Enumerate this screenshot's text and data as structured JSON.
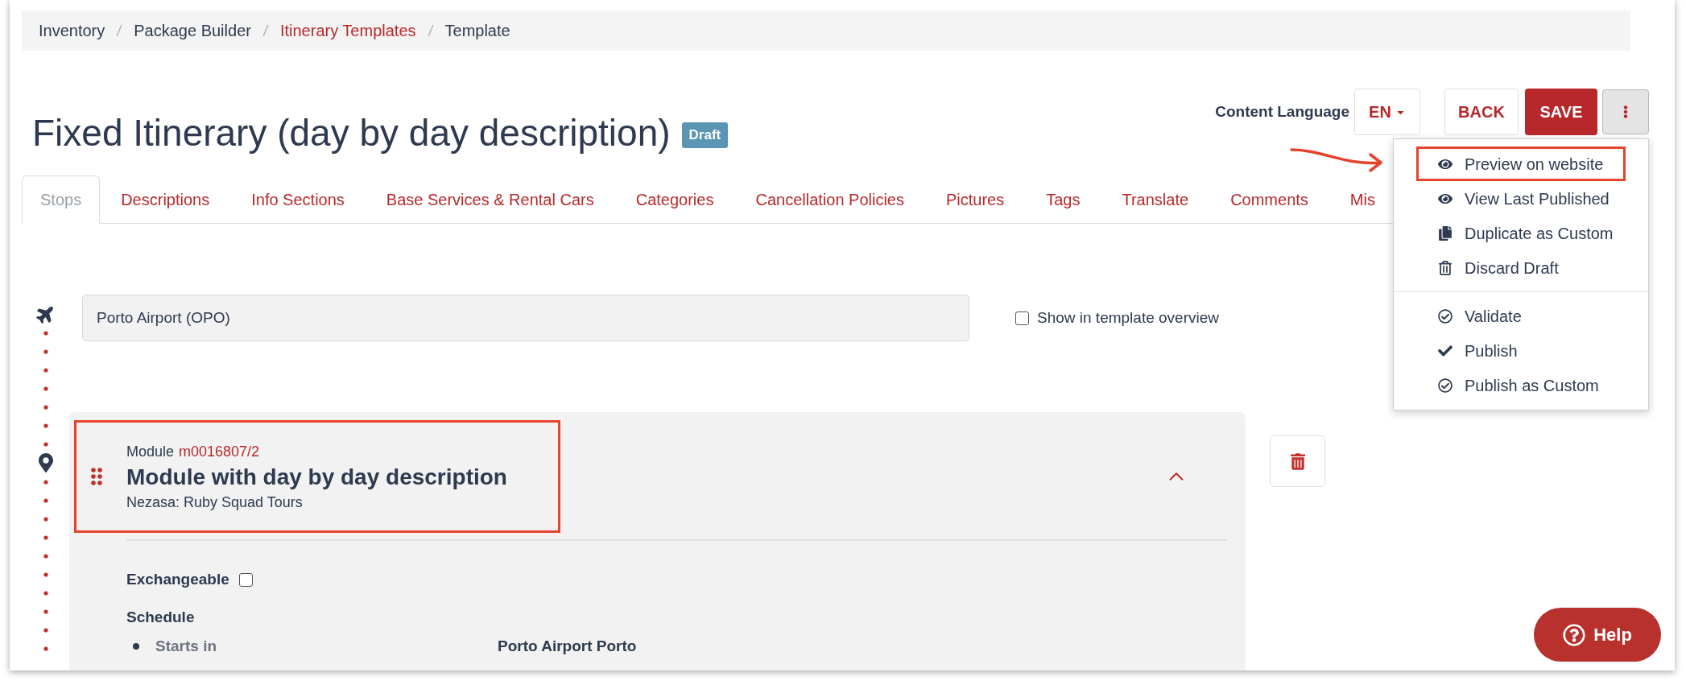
{
  "breadcrumbs": [
    {
      "label": "Inventory",
      "kind": "text"
    },
    {
      "label": "Package Builder",
      "kind": "text"
    },
    {
      "label": "Itinerary Templates",
      "kind": "link"
    },
    {
      "label": "Template",
      "kind": "text"
    }
  ],
  "title": "Fixed Itinerary (day by day description)",
  "status_badge": "Draft",
  "content_language": {
    "label": "Content Language",
    "value": "EN"
  },
  "buttons": {
    "back": "BACK",
    "save": "SAVE"
  },
  "menu": {
    "sections": [
      [
        {
          "label": "Preview on website",
          "annotated": true
        },
        {
          "label": "View Last Published",
          "annotated": false
        },
        {
          "label": "Duplicate as Custom",
          "annotated": false
        },
        {
          "label": "Discard Draft",
          "annotated": false
        }
      ],
      [
        {
          "label": "Validate",
          "annotated": false
        },
        {
          "label": "Publish",
          "annotated": false
        },
        {
          "label": "Publish as Custom",
          "annotated": false
        }
      ]
    ]
  },
  "tabs": [
    {
      "label": "Stops",
      "selected": true
    },
    {
      "label": "Descriptions",
      "selected": false
    },
    {
      "label": "Info Sections",
      "selected": false
    },
    {
      "label": "Base Services & Rental Cars",
      "selected": false
    },
    {
      "label": "Categories",
      "selected": false
    },
    {
      "label": "Cancellation Policies",
      "selected": false
    },
    {
      "label": "Pictures",
      "selected": false
    },
    {
      "label": "Tags",
      "selected": false
    },
    {
      "label": "Translate",
      "selected": false
    },
    {
      "label": "Comments",
      "selected": false
    },
    {
      "label": "Mis",
      "selected": false
    }
  ],
  "stop": {
    "value": "Porto Airport (OPO)",
    "show_in_overview": {
      "label": "Show in template overview",
      "checked": false
    }
  },
  "module": {
    "label": "Module",
    "id": "m0016807/2",
    "title": "Module with day by day description",
    "supplier": "Nezasa: Ruby Squad Tours",
    "annotated": true,
    "expanded": true,
    "exchangeable": {
      "label": "Exchangeable",
      "checked": false
    },
    "schedule_heading": "Schedule",
    "schedule": [
      {
        "label": "Starts in",
        "value": "Porto Airport Porto"
      }
    ]
  },
  "help": "Help"
}
